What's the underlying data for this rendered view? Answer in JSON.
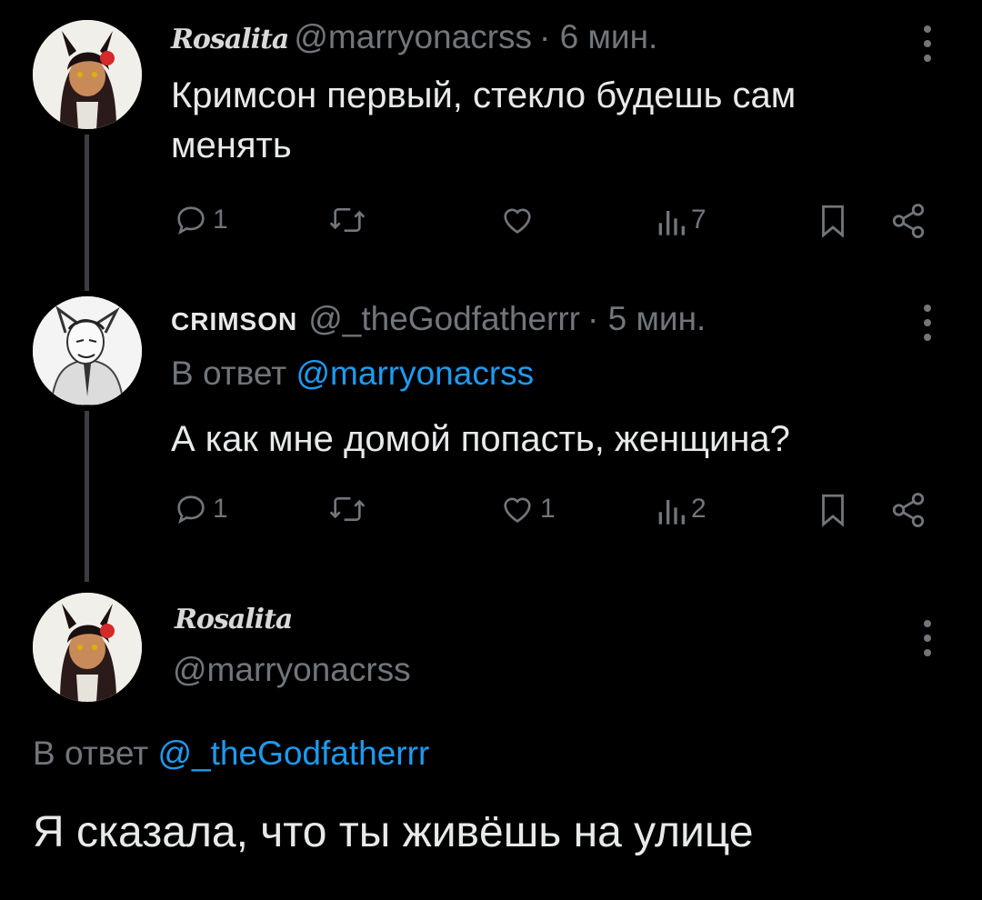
{
  "tweets": [
    {
      "display_name": "Rosalita",
      "handle": "@marryonacrss",
      "time": "· 6 мин.",
      "text_line1": "Кримсон первый, стекло будешь сам",
      "text_line2": "менять",
      "replies": "1",
      "likes": "",
      "views": "7"
    },
    {
      "display_name": "CRIMSON",
      "handle": "@_theGodfatherrr",
      "time": "· 5 мин.",
      "reply_prefix": "В ответ",
      "reply_to": "@marryonacrss",
      "text": "А как мне домой попасть, женщина?",
      "replies": "1",
      "likes": "1",
      "views": "2"
    }
  ],
  "main_tweet": {
    "display_name": "Rosalita",
    "handle": "@marryonacrss",
    "reply_prefix": "В ответ",
    "reply_to": "@_theGodfatherrr",
    "text": "Я сказала, что ты живёшь на улице"
  },
  "colors": {
    "background": "#000000",
    "text": "#e7e9ea",
    "muted": "#71767b",
    "link": "#1d9bf0"
  }
}
